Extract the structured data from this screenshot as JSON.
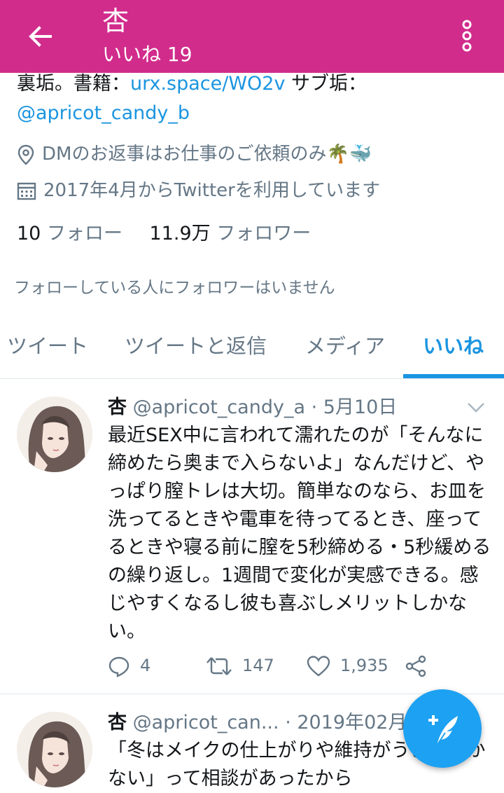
{
  "header": {
    "title": "杏",
    "subtitle": "いいね 19",
    "back_icon": "arrow-left-icon",
    "menu_icon": "more-vertical-icon",
    "color": "#d12c8c"
  },
  "profile": {
    "bio_prefix": "裏垢。書籍：",
    "bio_link": "urx.space/WO2v",
    "bio_suffix": " サブ垢：",
    "bio_handle": "@apricot_candy_b",
    "location": "DMのお返事はお仕事のご依頼のみ🌴🐳",
    "joined": "2017年4月からTwitterを利用しています",
    "following_count": "10",
    "following_label": "フォロー",
    "followers_count": "11.9万",
    "followers_label": "フォロワー",
    "notice": "フォローしている人にフォロワーはいません"
  },
  "tabs": [
    {
      "label": "ツイート"
    },
    {
      "label": "ツイートと返信"
    },
    {
      "label": "メディア"
    },
    {
      "label": "いいね",
      "active": true
    }
  ],
  "tweets": [
    {
      "name": "杏",
      "handle": "@apricot_candy_a",
      "date": "· 5月10日",
      "text": "最近SEX中に言われて濡れたのが「そんなに締めたら奥まで入らないよ」なんだけど、やっぱり膣トレは大切。簡単なのなら、お皿を洗ってるときや電車を待ってるとき、座ってるときや寝る前に膣を5秒締める・5秒緩めるの繰り返し。1週間で変化が実感できる。感じやすくなるし彼も喜ぶしメリットしかない。",
      "replies": "4",
      "retweets": "147",
      "likes": "1,935"
    },
    {
      "name": "杏",
      "handle": "@apricot_can...",
      "date": "· 2019年02月",
      "text": "「冬はメイクの仕上がりや維持がうまくいかない」って相談があったから"
    }
  ],
  "fab": {
    "icon": "compose-tweet-icon",
    "color": "#1da1f2"
  },
  "accent": "#1b95e0"
}
